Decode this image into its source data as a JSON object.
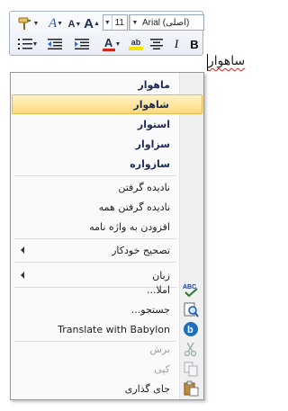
{
  "toolbar": {
    "font_name": "Arial (اصلی)",
    "font_size": "11",
    "bold": "B",
    "italic": "I",
    "grow_font": "A",
    "shrink_font": "A",
    "font_color_glyph": "A",
    "highlight_glyph": "ab",
    "font_color": "#d0261c",
    "highlight_color": "#f5e600"
  },
  "document": {
    "word": "ساهوار"
  },
  "menu": {
    "suggestions": [
      "ماهوار",
      "شاهوار",
      "استوار",
      "سزاوار",
      "سازواره"
    ],
    "ignore": "نادیده گرفتن",
    "ignore_all": "نادیده گرفتن همه",
    "add_to_dictionary": "افزودن به واژه نامه",
    "autocorrect": "تصحیح خودکار",
    "language": "زبان",
    "spelling": "املا...",
    "look_up": "جستجو...",
    "translate": "Translate with Babylon",
    "cut": "برش",
    "copy": "کپی",
    "paste": "جای گذاری"
  }
}
